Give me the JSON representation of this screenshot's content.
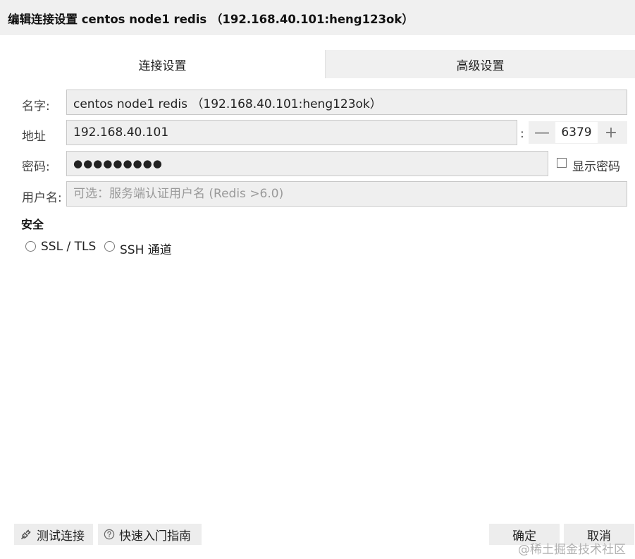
{
  "dialog": {
    "title": "编辑连接设置 centos node1 redis （192.168.40.101:heng123ok）"
  },
  "tabs": [
    {
      "label": "连接设置"
    },
    {
      "label": "高级设置"
    }
  ],
  "form": {
    "name_label": "名字:",
    "name_value": "centos node1 redis （192.168.40.101:heng123ok）",
    "address_label": "地址",
    "address_value": "192.168.40.101",
    "port_separator": ":",
    "port_minus": "—",
    "port_value": "6379",
    "port_plus": "+",
    "password_label": "密码:",
    "password_value": "●●●●●●●●●",
    "show_password_label": "显示密码",
    "username_label": "用户名:",
    "username_placeholder": "可选：服务端认证用户名 (Redis >6.0)"
  },
  "security": {
    "title": "安全",
    "options": [
      {
        "label": "SSL / TLS"
      },
      {
        "label": "SSH 通道"
      }
    ]
  },
  "footer": {
    "test_button": "测试连接",
    "guide_button": "快速入门指南",
    "ok_button": "确定",
    "cancel_button": "取消"
  },
  "watermark": "@稀土掘金技术社区",
  "icons": {
    "test": "plug-icon",
    "guide": "help-circle-icon"
  }
}
